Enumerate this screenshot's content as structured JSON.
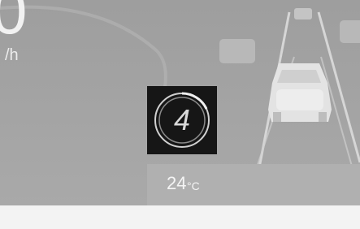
{
  "speed": {
    "value": "0",
    "unit": "/h"
  },
  "indicator": {
    "value": "4",
    "icon": "gear-indicator-icon"
  },
  "temperature": {
    "value": "24",
    "unit": "°C"
  },
  "colors": {
    "background": "#a1a1a1",
    "badge": "#161616",
    "text": "#f2f2f2"
  }
}
